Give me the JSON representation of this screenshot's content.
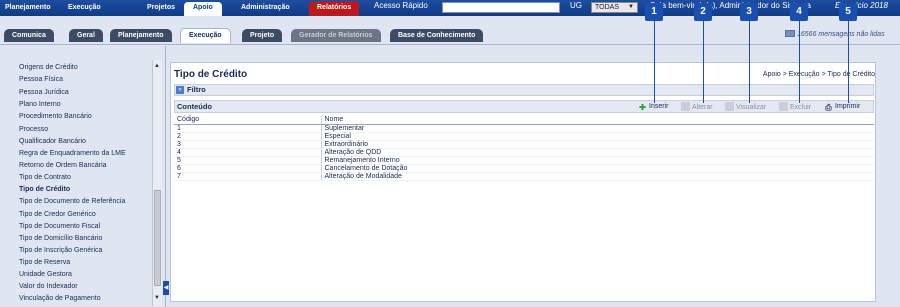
{
  "top_nav": {
    "items": [
      "Planejamento",
      "Execução",
      "Projetos",
      "Apoio",
      "Administração",
      "Relatórios"
    ],
    "quick_access_label": "Acesso Rápido",
    "ug_label": "UG",
    "ug_value": "TODAS",
    "welcome": "Seja bem-vindo(a), Administrador do Sistema",
    "exercicio": "Exercício 2018"
  },
  "sub_tabs": [
    "Comunica",
    "Geral",
    "Planejamento",
    "Execução",
    "Projeto",
    "Gerador de Relatórios",
    "Base de Conhecimento"
  ],
  "messages": "16566 mensagens não lidas",
  "sidebar": {
    "items": [
      "Origens de Crédito",
      "Pessoa Física",
      "Pessoa Jurídica",
      "Plano Interno",
      "Procedimento Bancário",
      "Processo",
      "Qualificador Bancário",
      "Regra de Enquadramento da LME",
      "Retorno de Ordem Bancária",
      "Tipo de Contrato",
      "Tipo de Crédito",
      "Tipo de Documento de Referência",
      "Tipo de Credor Genérico",
      "Tipo de Documento Fiscal",
      "Tipo de Domicílio Bancário",
      "Tipo de Inscrição Genérica",
      "Tipo de Reserva",
      "Unidade Gestora",
      "Valor do Indexador",
      "Vinculação de Pagamento"
    ],
    "active_index": 10
  },
  "main": {
    "title": "Tipo de Crédito",
    "breadcrumb": "Apoio > Execução > Tipo de Crédito",
    "filter_label": "Filtro",
    "content_label": "Conteúdo"
  },
  "toolbar": {
    "insert": "Inserir",
    "edit": "Alterar",
    "view": "Visualizar",
    "delete": "Excluir",
    "print": "Imprimir"
  },
  "badges": [
    "1",
    "2",
    "3",
    "4",
    "5"
  ],
  "table": {
    "headers": [
      "Código",
      "Nome"
    ],
    "rows": [
      [
        "1",
        "Suplementar"
      ],
      [
        "2",
        "Especial"
      ],
      [
        "3",
        "Extraordinário"
      ],
      [
        "4",
        "Alteração de QDD"
      ],
      [
        "5",
        "Remanejamento Interno"
      ],
      [
        "6",
        "Cancelamento de Dotação"
      ],
      [
        "7",
        "Alteração de Modalidade"
      ]
    ]
  }
}
